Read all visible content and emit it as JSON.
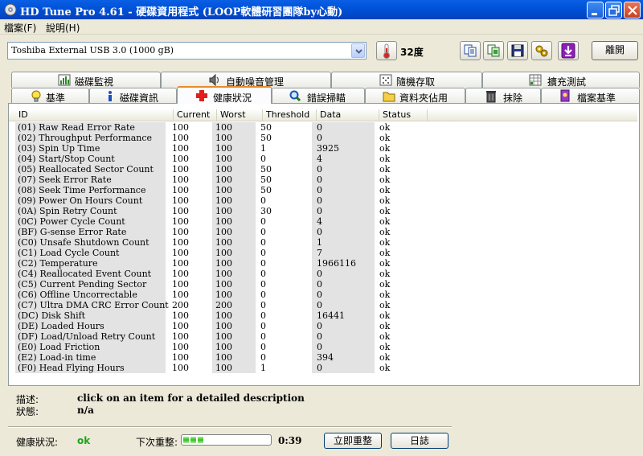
{
  "window": {
    "title": "HD Tune Pro 4.61 - 硬碟資用程式 (LOOP軟體研習團隊by心動)"
  },
  "menu": {
    "file": "檔案(F)",
    "help": "說明(H)"
  },
  "toolbar": {
    "drive": "Toshiba External USB 3.0 (1000 gB)",
    "temperature": "32度",
    "exit": "離開"
  },
  "tabs": {
    "row1": [
      "磁碟監視",
      "自動噪音管理",
      "隨機存取",
      "擴充測試"
    ],
    "row2": [
      "基準",
      "磁碟資訊",
      "健康狀況",
      "錯誤掃瞄",
      "資料夾佔用",
      "抹除",
      "檔案基準"
    ],
    "active": "健康狀況"
  },
  "table": {
    "headers": [
      "ID",
      "Current",
      "Worst",
      "Threshold",
      "Data",
      "Status"
    ],
    "rows": [
      [
        "(01) Raw Read Error Rate",
        "100",
        "100",
        "50",
        "0",
        "ok"
      ],
      [
        "(02) Throughput Performance",
        "100",
        "100",
        "50",
        "0",
        "ok"
      ],
      [
        "(03) Spin Up Time",
        "100",
        "100",
        "1",
        "3925",
        "ok"
      ],
      [
        "(04) Start/Stop Count",
        "100",
        "100",
        "0",
        "4",
        "ok"
      ],
      [
        "(05) Reallocated Sector Count",
        "100",
        "100",
        "50",
        "0",
        "ok"
      ],
      [
        "(07) Seek Error Rate",
        "100",
        "100",
        "50",
        "0",
        "ok"
      ],
      [
        "(08) Seek Time Performance",
        "100",
        "100",
        "50",
        "0",
        "ok"
      ],
      [
        "(09) Power On Hours Count",
        "100",
        "100",
        "0",
        "0",
        "ok"
      ],
      [
        "(0A) Spin Retry Count",
        "100",
        "100",
        "30",
        "0",
        "ok"
      ],
      [
        "(0C) Power Cycle Count",
        "100",
        "100",
        "0",
        "4",
        "ok"
      ],
      [
        "(BF) G-sense Error Rate",
        "100",
        "100",
        "0",
        "0",
        "ok"
      ],
      [
        "(C0) Unsafe Shutdown Count",
        "100",
        "100",
        "0",
        "1",
        "ok"
      ],
      [
        "(C1) Load Cycle Count",
        "100",
        "100",
        "0",
        "7",
        "ok"
      ],
      [
        "(C2) Temperature",
        "100",
        "100",
        "0",
        "1966116",
        "ok"
      ],
      [
        "(C4) Reallocated Event Count",
        "100",
        "100",
        "0",
        "0",
        "ok"
      ],
      [
        "(C5) Current Pending Sector",
        "100",
        "100",
        "0",
        "0",
        "ok"
      ],
      [
        "(C6) Offline Uncorrectable",
        "100",
        "100",
        "0",
        "0",
        "ok"
      ],
      [
        "(C7) Ultra DMA CRC Error Count",
        "200",
        "200",
        "0",
        "0",
        "ok"
      ],
      [
        "(DC) Disk Shift",
        "100",
        "100",
        "0",
        "16441",
        "ok"
      ],
      [
        "(DE) Loaded Hours",
        "100",
        "100",
        "0",
        "0",
        "ok"
      ],
      [
        "(DF) Load/Unload Retry Count",
        "100",
        "100",
        "0",
        "0",
        "ok"
      ],
      [
        "(E0) Load Friction",
        "100",
        "100",
        "0",
        "0",
        "ok"
      ],
      [
        "(E2) Load-in time",
        "100",
        "100",
        "0",
        "394",
        "ok"
      ],
      [
        "(F0) Head Flying Hours",
        "100",
        "100",
        "1",
        "0",
        "ok"
      ]
    ]
  },
  "details": {
    "description_label": "描述:",
    "description_value": "click on an item for a detailed description",
    "status_label": "狀態:",
    "status_value": "n/a"
  },
  "footer": {
    "health_label": "健康狀況:",
    "health_value": "ok",
    "health_color": "#1aa51a",
    "next_refresh_label": "下次重整:",
    "refresh_progress": 0.3,
    "countdown": "0:39",
    "refresh_now": "立即重整",
    "log": "日誌"
  }
}
